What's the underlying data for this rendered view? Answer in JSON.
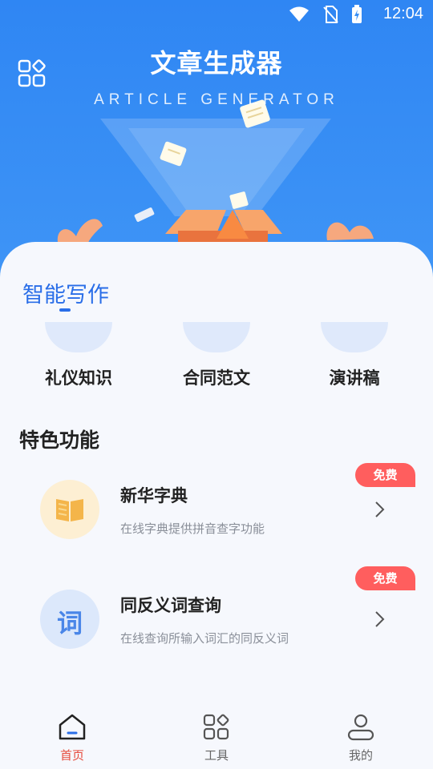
{
  "status_bar": {
    "time": "12:04",
    "icons": [
      "wifi-icon",
      "no-sim-icon",
      "battery-charging-icon"
    ]
  },
  "header": {
    "title": "文章生成器",
    "subtitle": "ARTICLE GENERATOR",
    "menu_icon": "grid-apps-icon",
    "background_color": "#3a90f5"
  },
  "smart_writing": {
    "title": "智能写作",
    "categories": [
      {
        "label": "礼仪知识"
      },
      {
        "label": "合同范文"
      },
      {
        "label": "演讲稿"
      }
    ]
  },
  "features": {
    "title": "特色功能",
    "items": [
      {
        "name": "新华字典",
        "desc": "在线字典提供拼音查字功能",
        "badge": "免费",
        "icon": "book-icon",
        "icon_bg": "#fdefd3"
      },
      {
        "name": "同反义词查询",
        "desc": "在线查询所输入词汇的同反义词",
        "badge": "免费",
        "icon": "ci-character-icon",
        "icon_glyph": "词",
        "icon_bg": "#dce8fb"
      }
    ]
  },
  "tabbar": {
    "tabs": [
      {
        "label": "首页",
        "icon": "home-icon",
        "active": true
      },
      {
        "label": "工具",
        "icon": "tools-grid-icon",
        "active": false
      },
      {
        "label": "我的",
        "icon": "profile-icon",
        "active": false
      }
    ],
    "active_color": "#e64b3c",
    "inactive_color": "#666666"
  }
}
